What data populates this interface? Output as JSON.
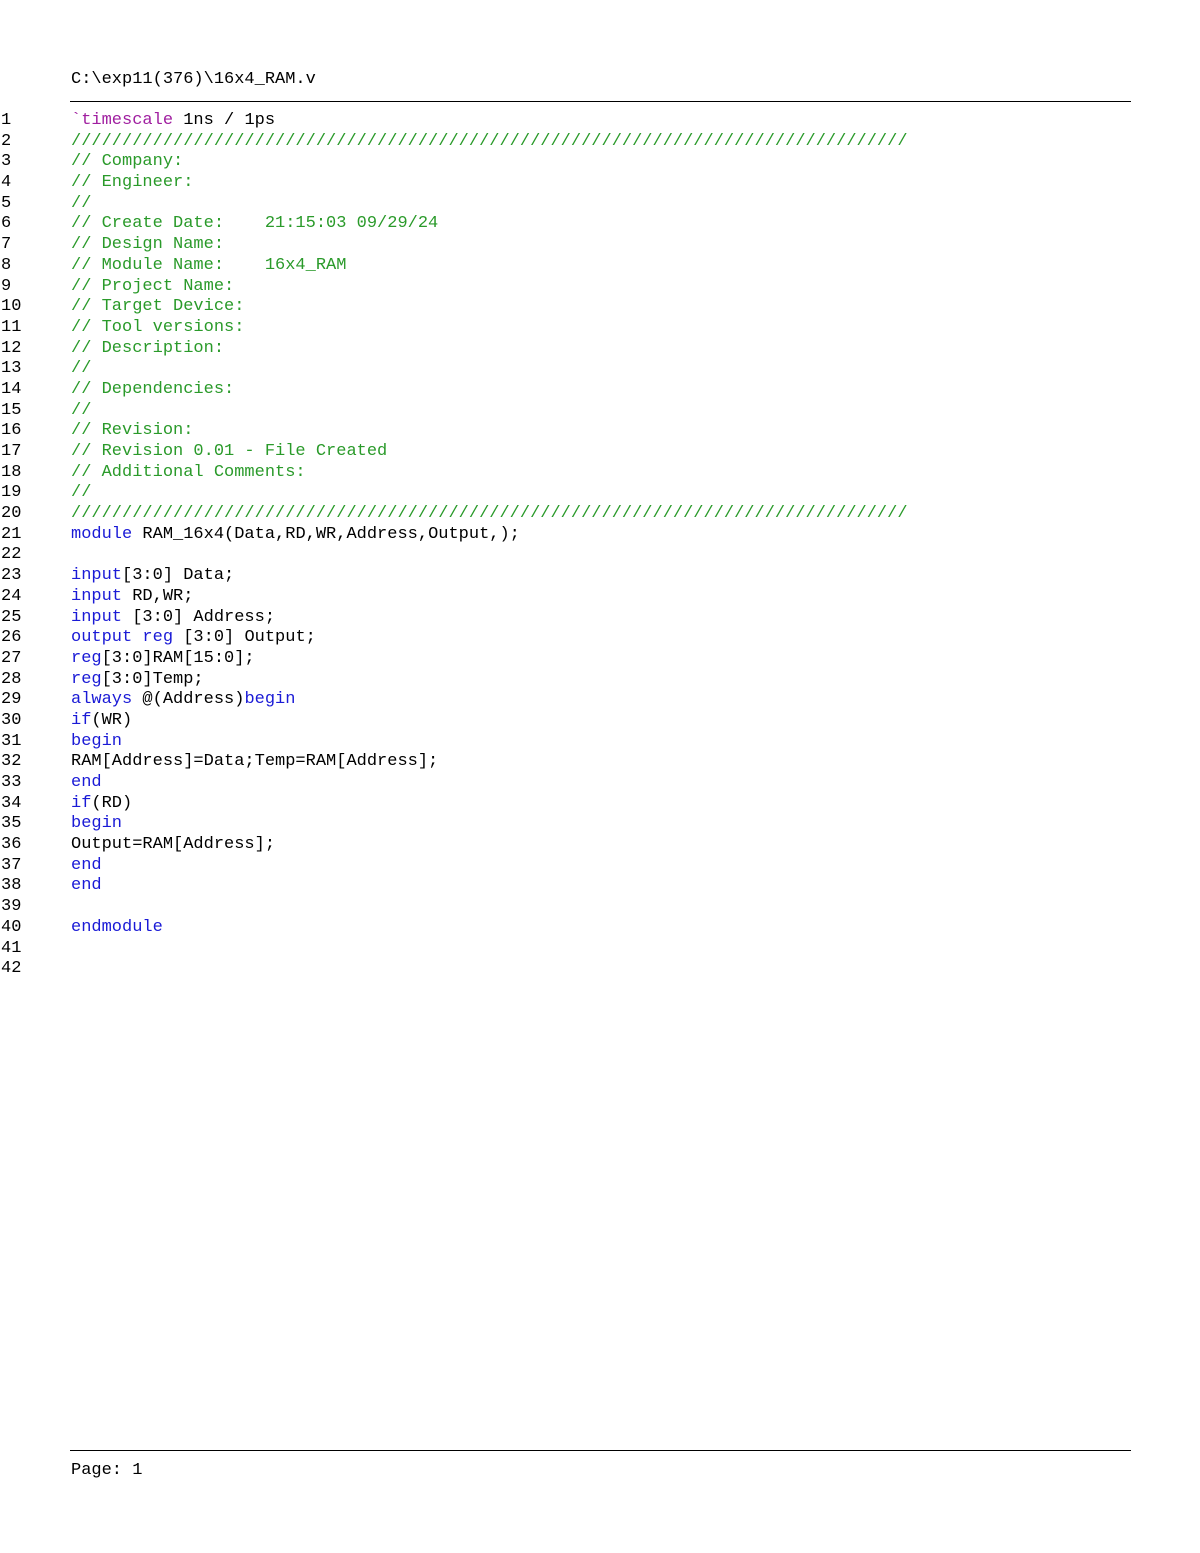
{
  "header": {
    "file_path": "C:\\exp11(376)\\16x4_RAM.v"
  },
  "colors": {
    "comment": "#2a9a2a",
    "keyword": "#1a1ad6",
    "directive": "#a01fa0",
    "plain": "#000000"
  },
  "code_lines": [
    {
      "num": "1",
      "tokens": [
        {
          "t": "`timescale",
          "k": "directive"
        },
        {
          "t": " 1ns / 1ps",
          "k": "plain"
        }
      ]
    },
    {
      "num": "2",
      "tokens": [
        {
          "t": "//////////////////////////////////////////////////////////////////////////////////",
          "k": "comment"
        }
      ]
    },
    {
      "num": "3",
      "tokens": [
        {
          "t": "// Company: ",
          "k": "comment"
        }
      ]
    },
    {
      "num": "4",
      "tokens": [
        {
          "t": "// Engineer: ",
          "k": "comment"
        }
      ]
    },
    {
      "num": "5",
      "tokens": [
        {
          "t": "// ",
          "k": "comment"
        }
      ]
    },
    {
      "num": "6",
      "tokens": [
        {
          "t": "// Create Date:    21:15:03 09/29/24 ",
          "k": "comment"
        }
      ]
    },
    {
      "num": "7",
      "tokens": [
        {
          "t": "// Design Name: ",
          "k": "comment"
        }
      ]
    },
    {
      "num": "8",
      "tokens": [
        {
          "t": "// Module Name:    16x4_RAM ",
          "k": "comment"
        }
      ]
    },
    {
      "num": "9",
      "tokens": [
        {
          "t": "// Project Name: ",
          "k": "comment"
        }
      ]
    },
    {
      "num": "10",
      "tokens": [
        {
          "t": "// Target Device: ",
          "k": "comment"
        }
      ]
    },
    {
      "num": "11",
      "tokens": [
        {
          "t": "// Tool versions: ",
          "k": "comment"
        }
      ]
    },
    {
      "num": "12",
      "tokens": [
        {
          "t": "// Description: ",
          "k": "comment"
        }
      ]
    },
    {
      "num": "13",
      "tokens": [
        {
          "t": "//",
          "k": "comment"
        }
      ]
    },
    {
      "num": "14",
      "tokens": [
        {
          "t": "// Dependencies: ",
          "k": "comment"
        }
      ]
    },
    {
      "num": "15",
      "tokens": [
        {
          "t": "//",
          "k": "comment"
        }
      ]
    },
    {
      "num": "16",
      "tokens": [
        {
          "t": "// Revision: ",
          "k": "comment"
        }
      ]
    },
    {
      "num": "17",
      "tokens": [
        {
          "t": "// Revision 0.01 - File Created",
          "k": "comment"
        }
      ]
    },
    {
      "num": "18",
      "tokens": [
        {
          "t": "// Additional Comments: ",
          "k": "comment"
        }
      ]
    },
    {
      "num": "19",
      "tokens": [
        {
          "t": "//",
          "k": "comment"
        }
      ]
    },
    {
      "num": "20",
      "tokens": [
        {
          "t": "//////////////////////////////////////////////////////////////////////////////////",
          "k": "comment"
        }
      ]
    },
    {
      "num": "21",
      "tokens": [
        {
          "t": "module",
          "k": "keyword"
        },
        {
          "t": " RAM_16x4(Data,RD,WR,Address,Output,);",
          "k": "plain"
        }
      ]
    },
    {
      "num": "22",
      "tokens": []
    },
    {
      "num": "23",
      "tokens": [
        {
          "t": "input",
          "k": "keyword"
        },
        {
          "t": "[3:0] Data;",
          "k": "plain"
        }
      ]
    },
    {
      "num": "24",
      "tokens": [
        {
          "t": "input",
          "k": "keyword"
        },
        {
          "t": " RD,WR;",
          "k": "plain"
        }
      ]
    },
    {
      "num": "25",
      "tokens": [
        {
          "t": "input",
          "k": "keyword"
        },
        {
          "t": " [3:0] Address;",
          "k": "plain"
        }
      ]
    },
    {
      "num": "26",
      "tokens": [
        {
          "t": "output",
          "k": "keyword"
        },
        {
          "t": " ",
          "k": "plain"
        },
        {
          "t": "reg",
          "k": "keyword"
        },
        {
          "t": " [3:0] Output;",
          "k": "plain"
        }
      ]
    },
    {
      "num": "27",
      "tokens": [
        {
          "t": "reg",
          "k": "keyword"
        },
        {
          "t": "[3:0]RAM[15:0];",
          "k": "plain"
        }
      ]
    },
    {
      "num": "28",
      "tokens": [
        {
          "t": "reg",
          "k": "keyword"
        },
        {
          "t": "[3:0]Temp;",
          "k": "plain"
        }
      ]
    },
    {
      "num": "29",
      "tokens": [
        {
          "t": "always",
          "k": "keyword"
        },
        {
          "t": " @(Address)",
          "k": "plain"
        },
        {
          "t": "begin",
          "k": "keyword"
        }
      ]
    },
    {
      "num": "30",
      "tokens": [
        {
          "t": "if",
          "k": "keyword"
        },
        {
          "t": "(WR)",
          "k": "plain"
        }
      ]
    },
    {
      "num": "31",
      "tokens": [
        {
          "t": "begin",
          "k": "keyword"
        }
      ]
    },
    {
      "num": "32",
      "tokens": [
        {
          "t": "RAM[Address]=Data;Temp=RAM[Address];",
          "k": "plain"
        }
      ]
    },
    {
      "num": "33",
      "tokens": [
        {
          "t": "end",
          "k": "keyword"
        }
      ]
    },
    {
      "num": "34",
      "tokens": [
        {
          "t": "if",
          "k": "keyword"
        },
        {
          "t": "(RD)",
          "k": "plain"
        }
      ]
    },
    {
      "num": "35",
      "tokens": [
        {
          "t": "begin",
          "k": "keyword"
        }
      ]
    },
    {
      "num": "36",
      "tokens": [
        {
          "t": "Output=RAM[Address];",
          "k": "plain"
        }
      ]
    },
    {
      "num": "37",
      "tokens": [
        {
          "t": "end",
          "k": "keyword"
        }
      ]
    },
    {
      "num": "38",
      "tokens": [
        {
          "t": "end",
          "k": "keyword"
        }
      ]
    },
    {
      "num": "39",
      "tokens": []
    },
    {
      "num": "40",
      "tokens": [
        {
          "t": "endmodule",
          "k": "keyword"
        }
      ]
    },
    {
      "num": "41",
      "tokens": []
    },
    {
      "num": "42",
      "tokens": []
    }
  ],
  "footer": {
    "page_label": "Page: 1"
  }
}
